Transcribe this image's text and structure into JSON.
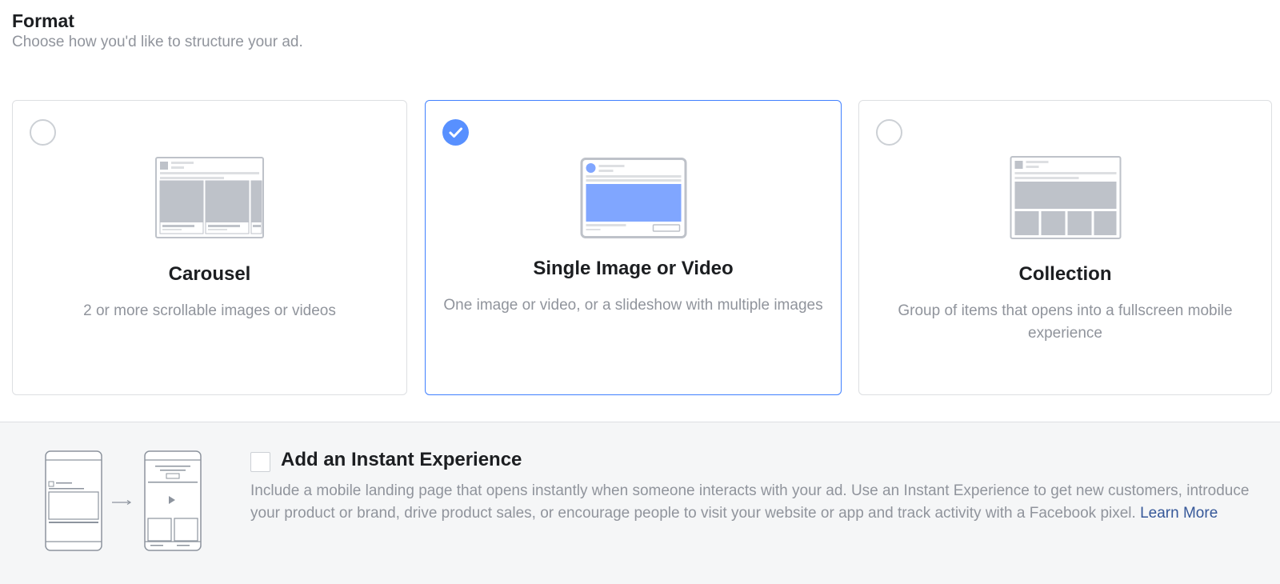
{
  "header": {
    "title": "Format",
    "subtitle": "Choose how you'd like to structure your ad."
  },
  "formats": [
    {
      "title": "Carousel",
      "description": "2 or more scrollable images or videos",
      "selected": false,
      "icon": "carousel-illustration-icon"
    },
    {
      "title": "Single Image or Video",
      "description": "One image or video, or a slideshow with multiple images",
      "selected": true,
      "icon": "single-image-illustration-icon"
    },
    {
      "title": "Collection",
      "description": "Group of items that opens into a fullscreen mobile experience",
      "selected": false,
      "icon": "collection-illustration-icon"
    }
  ],
  "instant_experience": {
    "title": "Add an Instant Experience",
    "checked": false,
    "description": "Include a mobile landing page that opens instantly when someone interacts with your ad. Use an Instant Experience to get new customers, introduce your product or brand, drive product sales, or encourage people to visit your website or app and track activity with a Facebook pixel.",
    "link_label": "Learn More",
    "icon": "instant-experience-illustration-icon"
  },
  "colors": {
    "accent": "#4080ff",
    "check_fill": "#5890ff",
    "placeholder_gray": "#bec2c9",
    "image_blue": "#80a6ff",
    "link": "#365899",
    "muted_text": "#90949c"
  }
}
